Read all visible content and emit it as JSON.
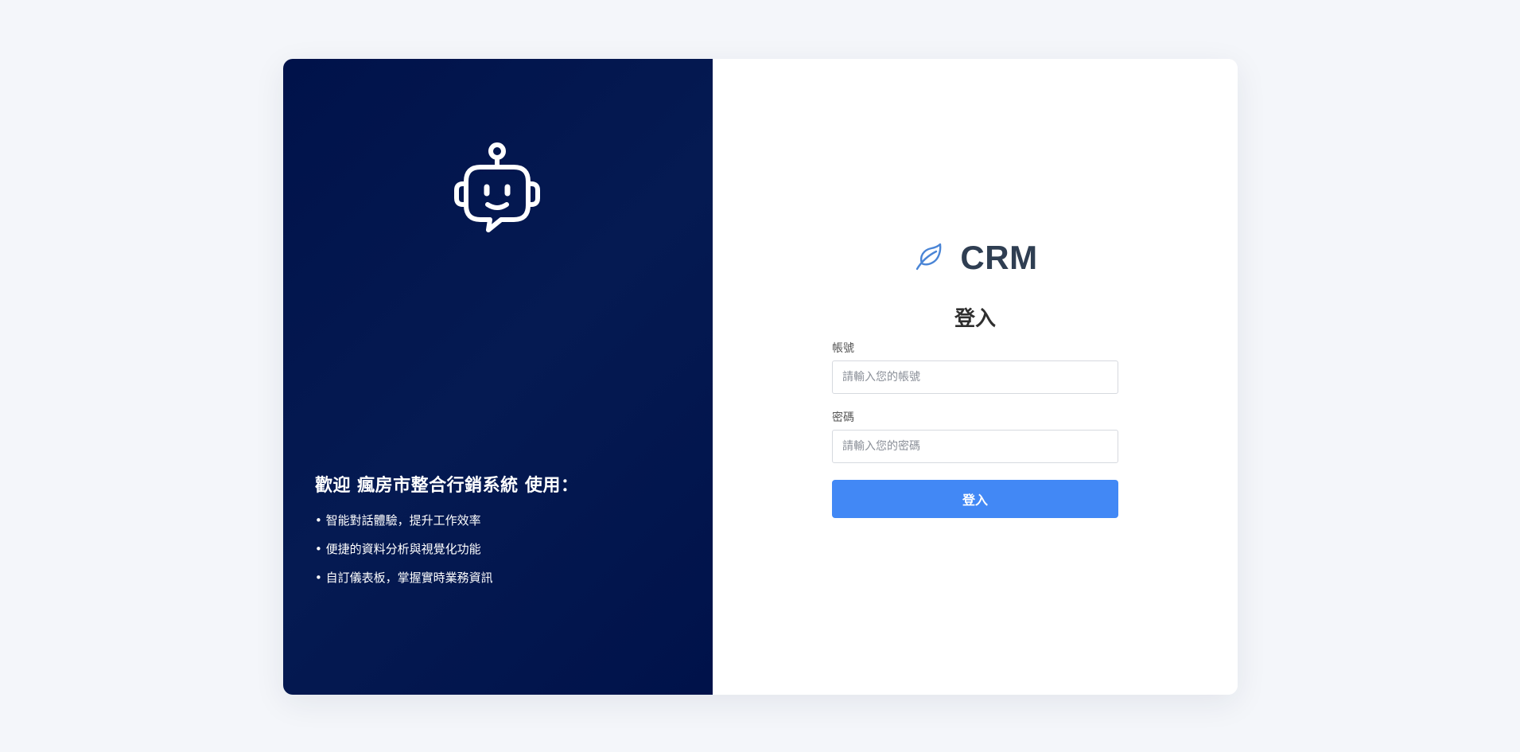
{
  "icons": {
    "robot": "robot-chat-icon",
    "leaf": "leaf-icon"
  },
  "colors": {
    "left_panel_bg": "#00124a",
    "accent": "#4288f5",
    "brand_text": "#2f3e52",
    "page_bg": "#f4f6fa"
  },
  "left_panel": {
    "welcome_title": "歡迎 瘋房市整合行銷系統 使用：",
    "features": [
      "• 智能對話體驗，提升工作效率",
      "• 便捷的資料分析與視覺化功能",
      "• 自訂儀表板，掌握實時業務資訊"
    ]
  },
  "brand": {
    "name": "CRM"
  },
  "login_form": {
    "title": "登入",
    "username_label": "帳號",
    "username_placeholder": "請輸入您的帳號",
    "username_value": "",
    "password_label": "密碼",
    "password_placeholder": "請輸入您的密碼",
    "password_value": "",
    "submit_label": "登入"
  }
}
